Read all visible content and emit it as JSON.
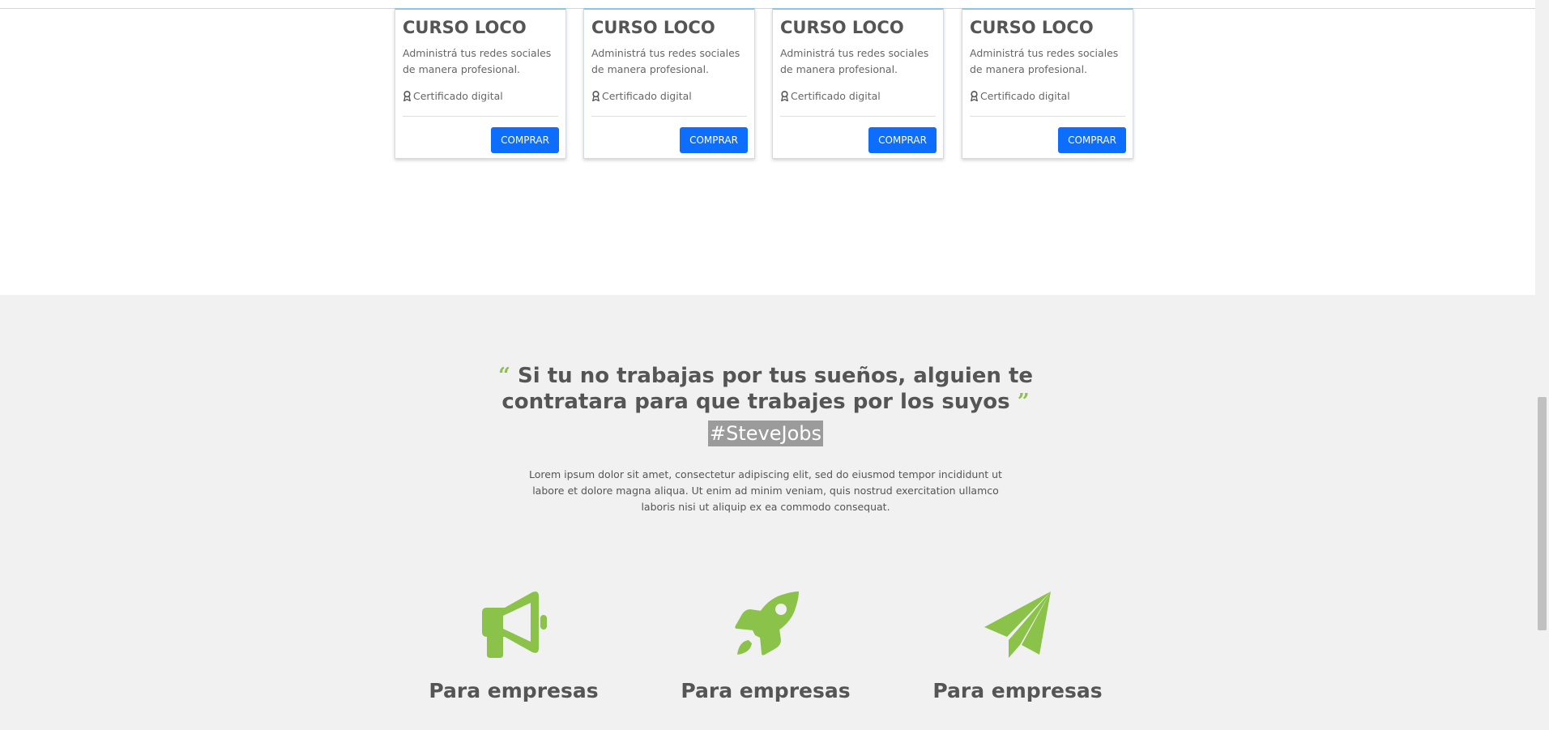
{
  "courses": [
    {
      "title": "CURSO LOCO",
      "description": "Administrá tus redes sociales de manera profesional.",
      "certificate": "Certificado digital",
      "buy_label": "COMPRAR"
    },
    {
      "title": "CURSO LOCO",
      "description": "Administrá tus redes sociales de manera profesional.",
      "certificate": "Certificado digital",
      "buy_label": "COMPRAR"
    },
    {
      "title": "CURSO LOCO",
      "description": "Administrá tus redes sociales de manera profesional.",
      "certificate": "Certificado digital",
      "buy_label": "COMPRAR"
    },
    {
      "title": "CURSO LOCO",
      "description": "Administrá tus redes sociales de manera profesional.",
      "certificate": "Certificado digital",
      "buy_label": "COMPRAR"
    }
  ],
  "quote": {
    "text": "Si tu no trabajas por tus sueños, alguien te contratara para que trabajes por los suyos",
    "hashtag": "#SteveJobs",
    "body": "Lorem ipsum dolor sit amet, consectetur adipiscing elit, sed do eiusmod tempor incididunt ut labore et dolore magna aliqua. Ut enim ad minim veniam, quis nostrud exercitation ullamco laboris nisi ut aliquip ex ea commodo consequat."
  },
  "features": [
    {
      "icon": "megaphone-icon",
      "title": "Para empresas"
    },
    {
      "icon": "rocket-icon",
      "title": "Para empresas"
    },
    {
      "icon": "paper-plane-icon",
      "title": "Para empresas"
    }
  ],
  "colors": {
    "accent": "#8bc34a",
    "button": "#0d6efd",
    "section_bg": "#f1f1f1",
    "hashtag_bg": "#9b9b9b"
  }
}
